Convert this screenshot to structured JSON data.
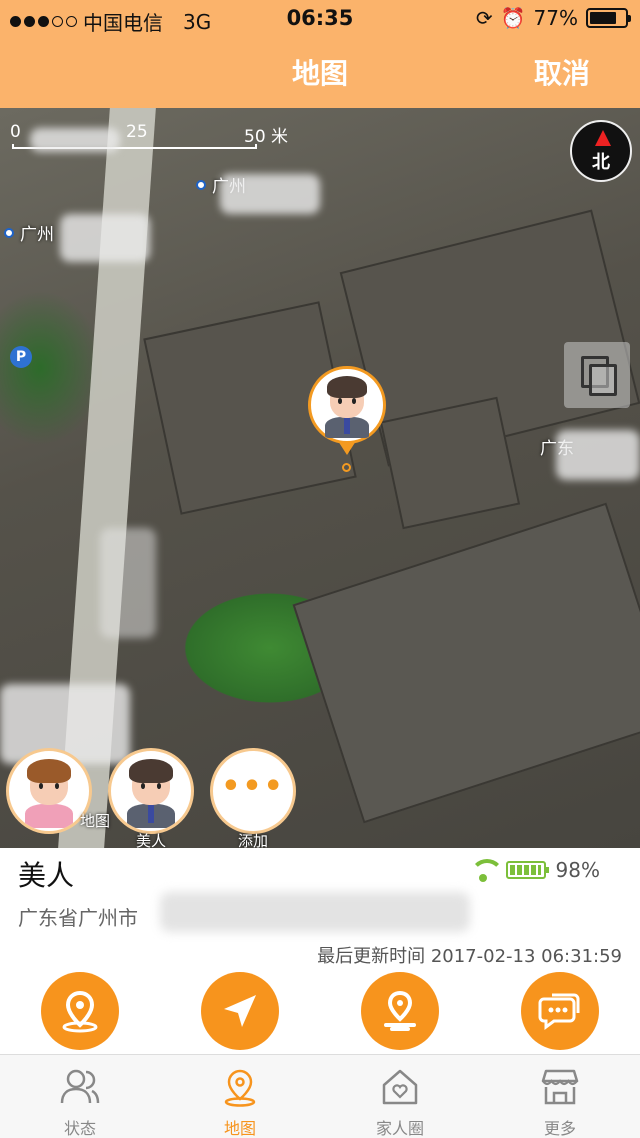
{
  "status_bar": {
    "carrier": "中国电信",
    "network": "3G",
    "time": "06:35",
    "battery_text": "77%",
    "battery_level": 0.77,
    "signal_bars": 3,
    "signal_total": 5
  },
  "header": {
    "title": "地图",
    "cancel_label": "取消"
  },
  "map": {
    "scale_labels": [
      "0",
      "25",
      "50 米"
    ],
    "poi_labels": [
      "广州",
      "广州",
      "广东"
    ],
    "compass_label": "北",
    "members": [
      {
        "label": ""
      },
      {
        "label": "美人"
      },
      {
        "label": "添加"
      }
    ],
    "footer_partial_text": "地图"
  },
  "info": {
    "name": "美人",
    "address": "广东省广州市",
    "battery_text": "98%",
    "battery_level": 0.98,
    "last_update": "最后更新时间 2017-02-13 06:31:59"
  },
  "actions": [
    {
      "icon": "location-pin-icon"
    },
    {
      "icon": "navigation-arrow-icon"
    },
    {
      "icon": "track-route-icon"
    },
    {
      "icon": "chat-icon"
    }
  ],
  "tabs": [
    {
      "label": "状态",
      "icon": "people-icon",
      "active": false
    },
    {
      "label": "地图",
      "icon": "map-pin-icon",
      "active": true
    },
    {
      "label": "家人圈",
      "icon": "home-heart-icon",
      "active": false
    },
    {
      "label": "更多",
      "icon": "store-icon",
      "active": false
    }
  ],
  "colors": {
    "accent": "#f7941d",
    "header": "#fbb36b",
    "battery_green": "#7cbf3a"
  }
}
